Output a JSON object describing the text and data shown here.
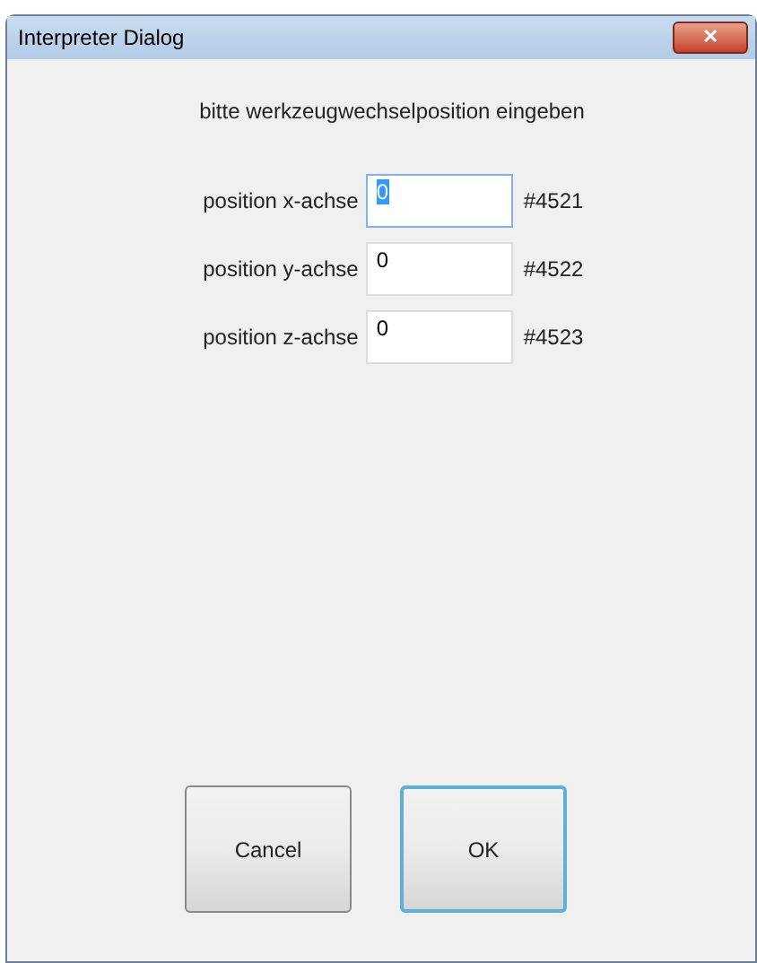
{
  "window": {
    "title": "Interpreter Dialog",
    "close_label": "✕"
  },
  "prompt": "bitte werkzeugwechselposition eingeben",
  "fields": [
    {
      "label": "position x-achse",
      "value": "0",
      "selected": true,
      "variable": "#4521"
    },
    {
      "label": "position y-achse",
      "value": "0",
      "selected": false,
      "variable": "#4522"
    },
    {
      "label": "position z-achse",
      "value": "0",
      "selected": false,
      "variable": "#4523"
    }
  ],
  "buttons": [
    {
      "label": "Cancel",
      "default": false
    },
    {
      "label": "OK",
      "default": true
    }
  ]
}
